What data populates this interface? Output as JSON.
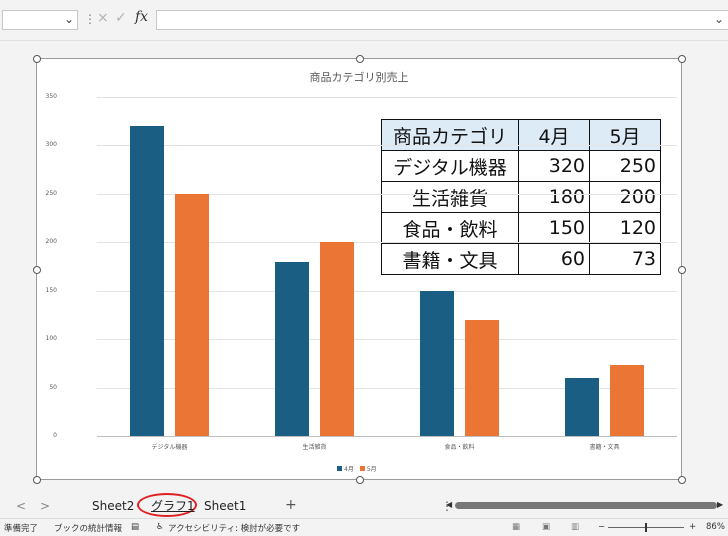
{
  "formula_bar": {
    "name_box_value": "",
    "fx_label": "fx",
    "cancel_glyph": "×",
    "enter_glyph": "✓",
    "formula_value": ""
  },
  "chart": {
    "title": "商品カテゴリ別売上",
    "y_ticks": [
      "350",
      "300",
      "250",
      "200",
      "150",
      "100",
      "50",
      "0"
    ],
    "legend": [
      "4月",
      "5月"
    ]
  },
  "chart_data": {
    "type": "bar",
    "title": "商品カテゴリ別売上",
    "categories": [
      "デジタル機器",
      "生活雑貨",
      "食品・飲料",
      "書籍・文具"
    ],
    "series": [
      {
        "name": "4月",
        "values": [
          320,
          180,
          150,
          60
        ],
        "color": "#1a5e84"
      },
      {
        "name": "5月",
        "values": [
          250,
          200,
          120,
          73
        ],
        "color": "#ea7535"
      }
    ],
    "ylim": [
      0,
      350
    ],
    "grid": true,
    "legend_position": "bottom"
  },
  "table": {
    "headers": [
      "商品カテゴリ",
      "4月",
      "5月"
    ],
    "rows": [
      [
        "デジタル機器",
        "320",
        "250"
      ],
      [
        "生活雑貨",
        "180",
        "200"
      ],
      [
        "食品・飲料",
        "150",
        "120"
      ],
      [
        "書籍・文具",
        "60",
        "73"
      ]
    ]
  },
  "tabs": {
    "prev": "<",
    "next": ">",
    "items": [
      "Sheet2",
      "グラフ1",
      "Sheet1"
    ],
    "active": "グラフ1",
    "add": "+"
  },
  "status": {
    "ready": "準備完了",
    "stats": "ブックの統計情報",
    "accessibility": "アクセシビリティ: 検討が必要です",
    "zoom": "86%",
    "zoom_minus": "−",
    "zoom_plus": "+"
  },
  "colors": {
    "series1": "#1a5e84",
    "series2": "#ea7535",
    "active_tab_highlight": "#e02020",
    "table_header_bg": "#ddebf7"
  }
}
